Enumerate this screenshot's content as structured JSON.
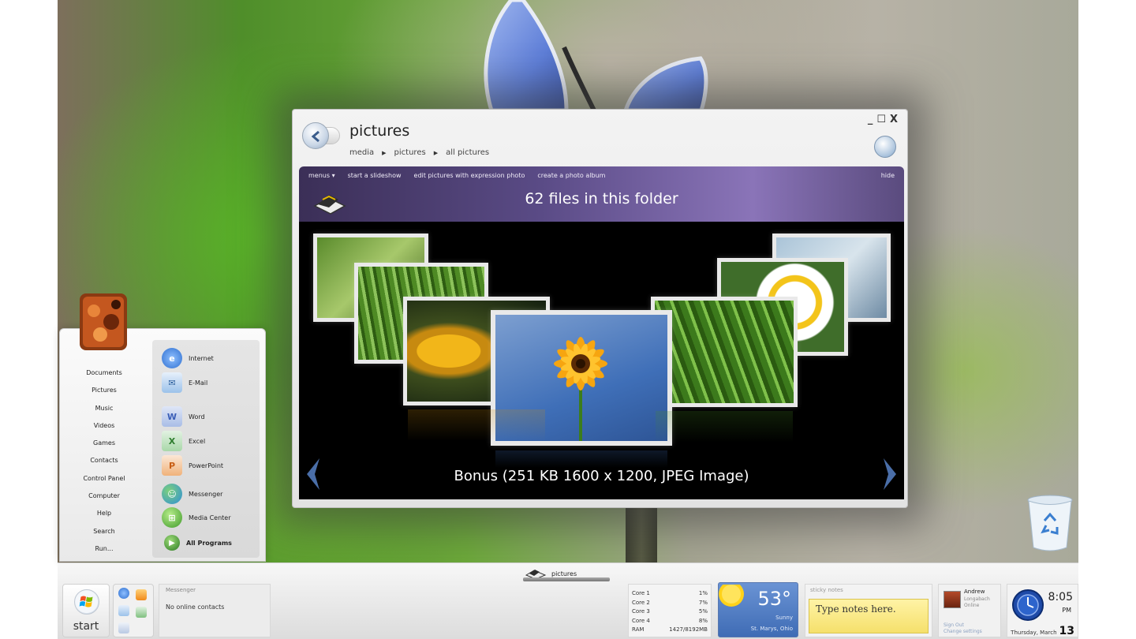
{
  "window": {
    "title": "pictures",
    "breadcrumb": [
      "media",
      "pictures",
      "all pictures"
    ],
    "controls": {
      "minimize": "_",
      "maximize": "☐",
      "close": "X"
    },
    "toolbar": {
      "menu_items": [
        "menus ▾",
        "start a slideshow",
        "edit pictures with expression photo",
        "create a photo album"
      ],
      "hide": "hide"
    },
    "folder_status": "62 files in this folder",
    "caption": "Bonus  (251 KB 1600 x 1200, JPEG Image)"
  },
  "start_menu": {
    "places": [
      "Documents",
      "Pictures",
      "Music",
      "Videos",
      "Games",
      "Contacts",
      "Control Panel",
      "Computer",
      "Help",
      "Search",
      "Run..."
    ],
    "programs": [
      {
        "label": "Internet",
        "icon": "internet-explorer-icon",
        "color": "#2f6fd0"
      },
      {
        "label": "E-Mail",
        "icon": "mail-icon",
        "color": "#3d8ad6"
      },
      {
        "label": "Word",
        "icon": "word-icon",
        "color": "#3c5fb8"
      },
      {
        "label": "Excel",
        "icon": "excel-icon",
        "color": "#3d9a3d"
      },
      {
        "label": "PowerPoint",
        "icon": "powerpoint-icon",
        "color": "#d2701f"
      },
      {
        "label": "Messenger",
        "icon": "messenger-icon",
        "color": "#3a9ad8"
      },
      {
        "label": "Media Center",
        "icon": "media-center-icon",
        "color": "#3f9a2a"
      },
      {
        "label": "All Programs",
        "icon": "arrow-right-icon",
        "color": "#2b7a22"
      }
    ]
  },
  "taskbar": {
    "start_label": "start",
    "task_button": "pictures",
    "messenger": {
      "title": "Messenger",
      "status": "No online contacts"
    },
    "cpu": [
      {
        "label": "Core 1",
        "value": "1%"
      },
      {
        "label": "Core 2",
        "value": "7%"
      },
      {
        "label": "Core 3",
        "value": "5%"
      },
      {
        "label": "Core 4",
        "value": "8%"
      },
      {
        "label": "RAM",
        "value": "1427/8192MB"
      }
    ],
    "weather": {
      "temp": "53°",
      "condition": "Sunny",
      "location": "St. Marys, Ohio"
    },
    "notes": {
      "title": "sticky notes",
      "text": "Type notes here."
    },
    "contact": {
      "name": "Andrew",
      "line1": "Longabach",
      "line2": "Online",
      "link1": "Sign Out",
      "link2": "Change settings"
    },
    "clock": {
      "time": "8:05",
      "ampm": "PM",
      "date_prefix": "Thursday, March",
      "date_day": "13"
    }
  }
}
